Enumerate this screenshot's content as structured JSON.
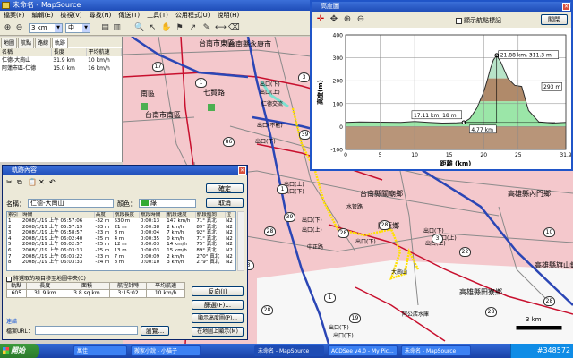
{
  "app": {
    "title": "未命名 - MapSource",
    "menu": [
      "檔案(F)",
      "編輯(E)",
      "檢視(V)",
      "尋找(N)",
      "傳送(T)",
      "工具(T)",
      "公用程式(U)",
      "說明(H)"
    ],
    "zoom_select": "3 km",
    "detail_select": "中"
  },
  "left_panel": {
    "tabs": [
      "地圖",
      "航點",
      "路線",
      "軌跡"
    ],
    "active_tab": "軌跡",
    "columns": [
      "名稱",
      "長度",
      "平均航速"
    ],
    "rows": [
      [
        "仁德-大崗山",
        "31.9 km",
        "10 km/h"
      ],
      [
        "阿蓮市區-仁德",
        "15.0 km",
        "16 km/h"
      ]
    ]
  },
  "map": {
    "labels": [
      {
        "text": "台南縣永康市",
        "name": "label-yongkang"
      },
      {
        "text": "台南市東區",
        "name": "label-east"
      },
      {
        "text": "七賢路",
        "name": "label-road"
      },
      {
        "text": "台南市南區",
        "name": "label-south"
      },
      {
        "text": "南區",
        "name": "label-nanqu"
      },
      {
        "text": "仁德交流",
        "name": "label-rende-ic"
      },
      {
        "text": "台南縣關廟鄉",
        "name": "label-guanmiao"
      },
      {
        "text": "高雄縣內門鄉",
        "name": "label-neimen"
      },
      {
        "text": "阿蓮鄉",
        "name": "label-alian"
      },
      {
        "text": "高雄縣田寮鄉",
        "name": "label-tianliao"
      },
      {
        "text": "高雄縣旗山鎮",
        "name": "label-qishan"
      },
      {
        "text": "大崗山",
        "name": "label-dagangshan"
      },
      {
        "text": "出口(下)",
        "name": "label-exit-1"
      },
      {
        "text": "出口(上)",
        "name": "label-exit-2"
      },
      {
        "text": "出口(不能)",
        "name": "label-exit-3"
      },
      {
        "text": "出口(下)",
        "name": "label-exit-4"
      },
      {
        "text": "出口(下)",
        "name": "label-exit-5"
      },
      {
        "text": "出口(上)",
        "name": "label-exit-6"
      },
      {
        "text": "出口(下)",
        "name": "label-exit-7"
      },
      {
        "text": "出口(上)",
        "name": "label-exit-8"
      },
      {
        "text": "出口(下)",
        "name": "label-exit-9"
      },
      {
        "text": "出口(上)",
        "name": "label-exit-10"
      },
      {
        "text": "出口(下)",
        "name": "label-exit-11"
      },
      {
        "text": "出口(下)",
        "name": "label-exit-12"
      },
      {
        "text": "出口(上)",
        "name": "label-exit-13"
      },
      {
        "text": "出口(下)",
        "name": "label-exit-14"
      },
      {
        "text": "阿公店水庫",
        "name": "label-reservoir"
      },
      {
        "text": "水管路",
        "name": "label-pipe"
      },
      {
        "text": "中正路",
        "name": "label-zhongzheng"
      }
    ],
    "road_numbers": [
      "17",
      "1",
      "3",
      "86",
      "39",
      "1",
      "28",
      "28",
      "28",
      "19",
      "3",
      "28",
      "39",
      "28",
      "10",
      "22",
      "1",
      "28",
      "3"
    ],
    "scale": "3 km",
    "scale_right": "3 km"
  },
  "profile": {
    "title": "高度圖",
    "checkbox_label": "顯示航點標記",
    "close_button": "關閉",
    "y_axis_label": "高度(m)",
    "x_axis_label": "距離 (km)",
    "annotations": {
      "peak": "21.88 km, 311.3 m",
      "start": "17.11 km, 18 m",
      "width": "4.77 km",
      "height": "293 m"
    }
  },
  "chart_data": {
    "type": "area",
    "xlabel": "距離 (km)",
    "ylabel": "高度(m)",
    "xlim": [
      0,
      31.9
    ],
    "ylim": [
      -100,
      400
    ],
    "x_ticks": [
      "0",
      "5",
      "10",
      "15",
      "20",
      "25",
      "31.9"
    ],
    "y_ticks": [
      "-100",
      "0",
      "100",
      "200",
      "300",
      "400"
    ],
    "x": [
      0,
      2,
      5,
      8,
      10,
      12,
      14,
      16,
      17.11,
      18,
      19,
      20,
      20.5,
      21,
      21.4,
      21.88,
      22.5,
      23.5,
      24.5,
      25.5,
      26.5,
      28,
      30,
      31.9
    ],
    "y": [
      18,
      20,
      19,
      18,
      22,
      18,
      15,
      16,
      18,
      35,
      80,
      150,
      200,
      255,
      290,
      311.3,
      280,
      210,
      180,
      175,
      70,
      20,
      15,
      18
    ],
    "colors": {
      "low": "#9be6a8",
      "mid": "#b08a6a",
      "high": "#b8e4c8",
      "line": "#2c2c2c"
    }
  },
  "track_dialog": {
    "title": "軌跡內容",
    "name_label": "名稱：",
    "name_value": "仁德-大崗山",
    "color_label": "顏色：",
    "color_value": "綠",
    "ok_button": "確定",
    "cancel_button": "取消",
    "columns": [
      "索引",
      "時間",
      "高度",
      "航段長度",
      "航段時間",
      "航段速度",
      "航段航向",
      "位"
    ],
    "rows": [
      [
        "1",
        "2008/1/19 上午 05:57:06",
        "-32 m",
        "530 m",
        "0:00:13",
        "147 km/h",
        "71° 真北",
        "N2"
      ],
      [
        "2",
        "2008/1/19 上午 05:57:19",
        "-33 m",
        "21 m",
        "0:00:38",
        "2 km/h",
        "89° 真北",
        "N2"
      ],
      [
        "3",
        "2008/1/19 上午 05:58:57",
        "-23 m",
        "8 m",
        "0:00:04",
        "7 km/h",
        "92° 真北",
        "N2"
      ],
      [
        "4",
        "2008/1/19 上午 06:02:40",
        "-25 m",
        "4 m",
        "0:00:35",
        "0 km/h",
        "71° 真北",
        "N2"
      ],
      [
        "5",
        "2008/1/19 上午 06:02:57",
        "-25 m",
        "12 m",
        "0:00:03",
        "14 km/h",
        "75° 真北",
        "N2"
      ],
      [
        "6",
        "2008/1/19 上午 06:03:13",
        "-25 m",
        "13 m",
        "0:00:03",
        "15 km/h",
        "89° 真北",
        "N2"
      ],
      [
        "7",
        "2008/1/19 上午 06:03:22",
        "-23 m",
        "7 m",
        "0:00:09",
        "2 km/h",
        "270° 真北",
        "N2"
      ],
      [
        "8",
        "2008/1/19 上午 06:03:33",
        "-24 m",
        "8 m",
        "0:00:10",
        "3 km/h",
        "279° 真北",
        "N2"
      ]
    ],
    "checkbox_label": "將選取的項目移至地圖中央(C)",
    "stats_columns": [
      "軌點",
      "長度",
      "面積",
      "航程計時",
      "平均航速"
    ],
    "stats_values": [
      "605",
      "31.9 km",
      "3.8 sq km",
      "3:15:02",
      "10 km/h"
    ],
    "side_buttons": [
      "反向(I)",
      "篩選(F)...",
      "顯示高度圖(P)...",
      "在地圖上顯示(M)"
    ],
    "link_label": "連結",
    "file_label": "檔案URL：",
    "browse_button": "瀏覽..."
  },
  "taskbar": {
    "start": "開始",
    "tasks": [
      "萬佳",
      "搬家小說 - 小貓子",
      "未命名 - MapSource",
      "ACDSee v4.0 - My Pic...",
      "未命名 - MapSource"
    ],
    "clock": "#348572"
  }
}
